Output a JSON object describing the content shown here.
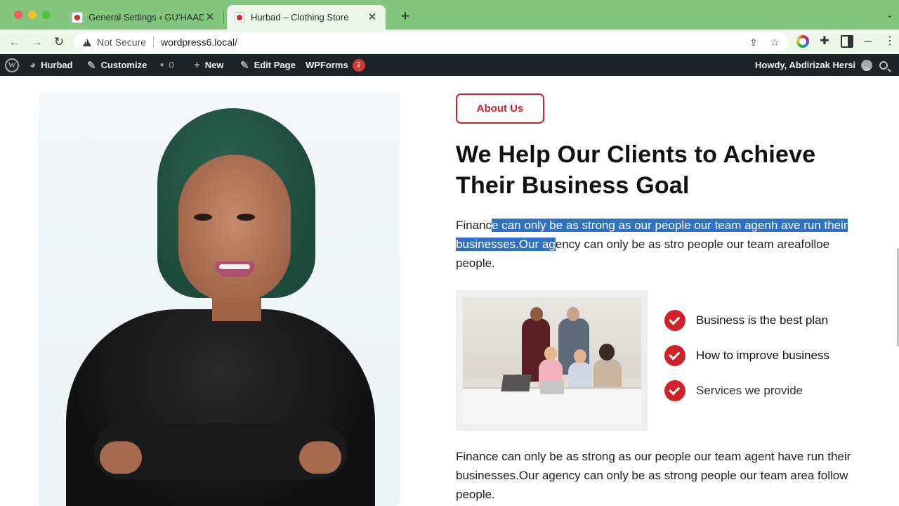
{
  "browser": {
    "tabs": [
      {
        "title": "General Settings ‹ GU'HAAD –",
        "active": false
      },
      {
        "title": "Hurbad – Clothing Store",
        "active": true
      }
    ],
    "security_label": "Not Secure",
    "url": "wordpress6.local/"
  },
  "adminbar": {
    "site_name": "Hurbad",
    "customize": "Customize",
    "comments_count": "0",
    "new": "New",
    "edit_page": "Edit Page",
    "wpforms": "WPForms",
    "wpforms_badge": "2",
    "howdy": "Howdy, Abdirizak Hersi"
  },
  "page": {
    "about_button": "About Us",
    "heading": "We Help Our Clients to Achieve Their Business Goal",
    "para1_pre": "Financ",
    "para1_selected": "e can only be as strong as our people our team agenh ave run their businesses.Our ag",
    "para1_post": "ency can only be as stro people our team areafolloe people.",
    "checklist": [
      "Business is the best plan",
      "How to improve business",
      "Services we provide"
    ],
    "para2": "Finance can only be as strong as our people our team agent have run their businesses.Our agency can only be as strong people our team area follow people."
  },
  "colors": {
    "accent": "#d0222a",
    "tabbar": "#83c77f",
    "selection": "#2f72c4",
    "adminbar": "#1d2327"
  }
}
